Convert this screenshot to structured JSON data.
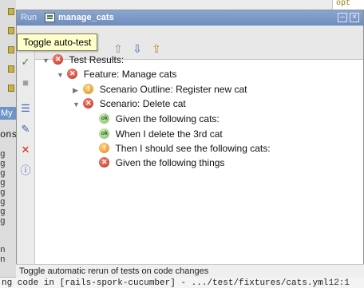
{
  "run_window": {
    "title_prefix": "Run",
    "config_name": "manage_cats"
  },
  "tooltip": {
    "text": "Toggle auto-test"
  },
  "tree": {
    "root": {
      "label": "Test Results:",
      "status": "fail"
    },
    "feature": {
      "label": "Feature: Manage cats",
      "status": "fail"
    },
    "scenario_outline": {
      "label": "Scenario Outline: Register new cat",
      "status": "warn"
    },
    "scenario": {
      "label": "Scenario: Delete cat",
      "status": "fail"
    },
    "steps": [
      {
        "label": "Given the following cats:",
        "status": "pass"
      },
      {
        "label": "When I delete the 3rd cat",
        "status": "pass"
      },
      {
        "label": "Then I should see the following cats:",
        "status": "warn"
      },
      {
        "label": "Given the following things",
        "status": "fail"
      }
    ]
  },
  "status_bar": {
    "text": "Toggle automatic rerun of tests on code changes"
  },
  "background": {
    "code_top": "opt",
    "tab_label": "My",
    "console_word": "ons",
    "gutter_chars": [
      "g",
      "g",
      "g",
      "g",
      "g",
      "g",
      "g",
      "g"
    ],
    "gutter_chars2": [
      "n",
      "n"
    ],
    "statusline_left": "ng code in [rails-spork-cucumber] - .../test/fixtures/cats.yml",
    "statusline_right": "12:1"
  },
  "icons": {
    "pass_glyph": "ok",
    "fail_glyph": "✕",
    "warn_glyph": "!"
  }
}
